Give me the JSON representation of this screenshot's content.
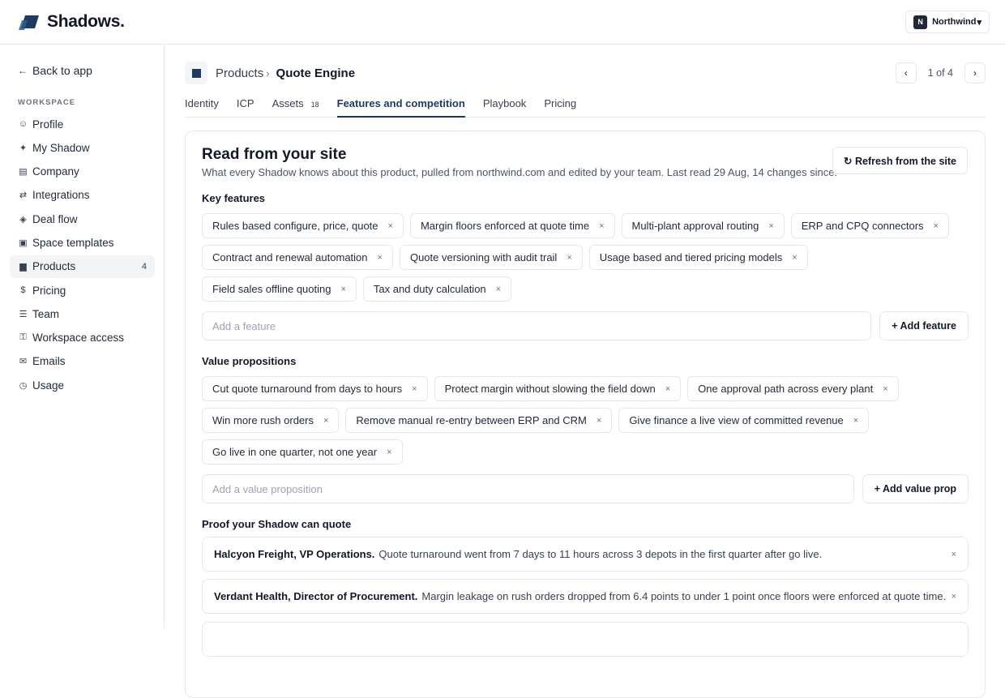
{
  "app": {
    "name": "Shadows."
  },
  "org": {
    "initial": "N",
    "name": "Northwind",
    "caret": "▾"
  },
  "sidebar": {
    "back_label": "Back to app",
    "back_icon": "←",
    "section_label": "WORKSPACE",
    "items": [
      {
        "icon": "☺",
        "label": "Profile"
      },
      {
        "icon": "✦",
        "label": "My Shadow"
      },
      {
        "icon": "▤",
        "label": "Company"
      },
      {
        "icon": "⇄",
        "label": "Integrations"
      },
      {
        "icon": "◈",
        "label": "Deal flow"
      },
      {
        "icon": "▣",
        "label": "Space templates"
      },
      {
        "icon": "▆",
        "label": "Products",
        "count": "4",
        "active": true
      },
      {
        "icon": "$",
        "label": "Pricing"
      },
      {
        "icon": "☰",
        "label": "Team"
      },
      {
        "icon": "⚿",
        "label": "Workspace access"
      },
      {
        "icon": "✉",
        "label": "Emails"
      },
      {
        "icon": "◷",
        "label": "Usage"
      }
    ]
  },
  "breadcrumb": {
    "parent": "Products",
    "separator": "›",
    "current": "Quote Engine"
  },
  "pager": {
    "text": "1 of 4",
    "prev": "‹",
    "next": "›"
  },
  "tabs": [
    {
      "label": "Identity"
    },
    {
      "label": "ICP"
    },
    {
      "label": "Assets",
      "count": "18"
    },
    {
      "label": "Features and competition",
      "active": true
    },
    {
      "label": "Playbook"
    },
    {
      "label": "Pricing"
    }
  ],
  "card": {
    "title": "Read from your site",
    "subtitle": "What every Shadow knows about this product, pulled from northwind.com and edited by your team. Last read 29 Aug, 14 changes since.",
    "refresh_label": "↻ Refresh from the site"
  },
  "key_features": {
    "label": "Key features",
    "items": [
      "Rules based configure, price, quote",
      "Margin floors enforced at quote time",
      "Multi-plant approval routing",
      "ERP and CPQ connectors",
      "Contract and renewal automation",
      "Quote versioning with audit trail",
      "Usage based and tiered pricing models",
      "Field sales offline quoting",
      "Tax and duty calculation"
    ],
    "placeholder": "Add a feature",
    "add_label": "+ Add feature"
  },
  "value_props": {
    "label": "Value propositions",
    "items": [
      "Cut quote turnaround from days to hours",
      "Protect margin without slowing the field down",
      "One approval path across every plant",
      "Win more rush orders",
      "Remove manual re-entry between ERP and CRM",
      "Give finance a live view of committed revenue",
      "Go live in one quarter, not one year"
    ],
    "placeholder": "Add a value proposition",
    "add_label": "+ Add value prop"
  },
  "proof": {
    "label": "Proof your Shadow can quote",
    "items": [
      {
        "who": "Halcyon Freight, VP Operations.",
        "text": "Quote turnaround went from 7 days to 11 hours across 3 depots in the first quarter after go live."
      },
      {
        "who": "Verdant Health, Director of Procurement.",
        "text": "Margin leakage on rush orders dropped from 6.4 points to under 1 point once floors were enforced at quote time."
      }
    ]
  },
  "remove_glyph": "×"
}
